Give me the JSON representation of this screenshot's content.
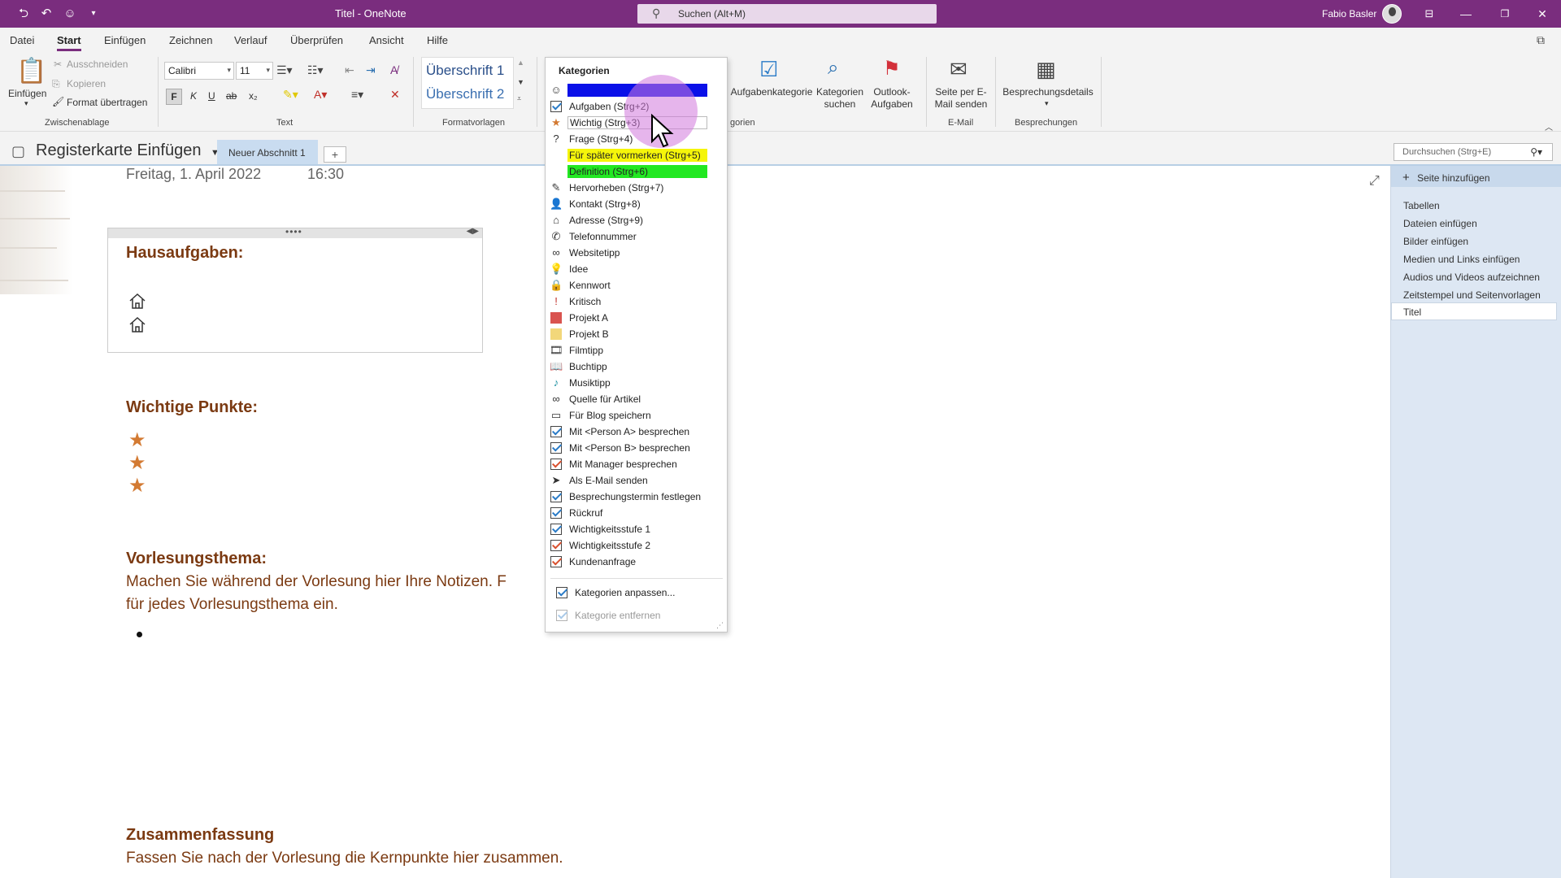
{
  "titlebar": {
    "window_title": "Titel  -  OneNote",
    "search_placeholder": "Suchen (Alt+M)",
    "user_name": "Fabio Basler"
  },
  "menu": {
    "tabs": [
      "Datei",
      "Start",
      "Einfügen",
      "Zeichnen",
      "Verlauf",
      "Überprüfen",
      "Ansicht",
      "Hilfe"
    ],
    "active": "Start"
  },
  "ribbon": {
    "clipboard": {
      "paste": "Einfügen",
      "cut": "Ausschneiden",
      "copy": "Kopieren",
      "format_painter": "Format übertragen",
      "label": "Zwischenablage"
    },
    "text": {
      "font": "Calibri",
      "size": "11",
      "bold": "F",
      "italic": "K",
      "underline": "U",
      "strike": "ab",
      "subscript": "x₂",
      "label": "Text"
    },
    "styles": {
      "style1": "Überschrift 1",
      "style2": "Überschrift 2",
      "label": "Formatvorlagen"
    },
    "tags": {
      "task_category": "Aufgabenkategorie",
      "find_tags": "Kategorien suchen",
      "outlook_tasks": "Outlook-Aufgaben",
      "label_partial": "gorien"
    },
    "email": {
      "send": "Seite per E-Mail senden",
      "label": "E-Mail"
    },
    "meetings": {
      "details": "Besprechungsdetails",
      "label": "Besprechungen"
    }
  },
  "nav": {
    "notebook": "Registerkarte Einfügen",
    "section_tab": "Neuer Abschnitt 1",
    "add_tab": "+",
    "search_placeholder": "Durchsuchen (Strg+E)"
  },
  "page": {
    "date": "Freitag, 1. April 2022",
    "time": "16:30",
    "homework_heading": "Hausaufgaben:",
    "important_heading": "Wichtige Punkte:",
    "lecture_heading": "Vorlesungsthema:",
    "lecture_text_1": "Machen Sie während der Vorlesung hier Ihre Notizen. F",
    "lecture_text_2": "für jedes Vorlesungsthema ein.",
    "summary_heading": "Zusammenfassung",
    "summary_text": "Fassen Sie nach der Vorlesung die Kernpunkte hier zusammen."
  },
  "right_pane": {
    "add_page": "Seite hinzufügen",
    "items": [
      "Tabellen",
      "Dateien einfügen",
      "Bilder einfügen",
      "Medien und Links einfügen",
      "Audios und Videos aufzeichnen",
      "Zeitstempel und Seitenvorlagen"
    ],
    "current_page": "Titel"
  },
  "dropdown": {
    "header": "Kategorien",
    "items": [
      {
        "label": "",
        "icon": "smiley-icon",
        "highlight": "#0a10e8"
      },
      {
        "label": "Aufgaben (Strg+2)",
        "icon": "checkbox-icon"
      },
      {
        "label": "Wichtig (Strg+3)",
        "icon": "star-icon"
      },
      {
        "label": "Frage (Strg+4)",
        "icon": "question-icon"
      },
      {
        "label": "Für später vormerken (Strg+5)",
        "icon": "none",
        "highlight": "#f5f50a"
      },
      {
        "label": "Definition (Strg+6)",
        "icon": "none",
        "highlight": "#22e822"
      },
      {
        "label": "Hervorheben (Strg+7)",
        "icon": "pen-icon"
      },
      {
        "label": "Kontakt (Strg+8)",
        "icon": "contact-icon"
      },
      {
        "label": "Adresse (Strg+9)",
        "icon": "home-icon"
      },
      {
        "label": "Telefonnummer",
        "icon": "phone-icon"
      },
      {
        "label": "Websitetipp",
        "icon": "link-icon"
      },
      {
        "label": "Idee",
        "icon": "lightbulb-icon"
      },
      {
        "label": "Kennwort",
        "icon": "lock-icon"
      },
      {
        "label": "Kritisch",
        "icon": "exclamation-icon"
      },
      {
        "label": "Projekt A",
        "icon": "red-square-icon"
      },
      {
        "label": "Projekt B",
        "icon": "yellow-square-icon"
      },
      {
        "label": "Filmtipp",
        "icon": "film-icon"
      },
      {
        "label": "Buchtipp",
        "icon": "book-icon"
      },
      {
        "label": "Musiktipp",
        "icon": "music-note-icon"
      },
      {
        "label": "Quelle für Artikel",
        "icon": "link-icon"
      },
      {
        "label": "Für Blog speichern",
        "icon": "comment-icon"
      },
      {
        "label": "Mit <Person A> besprechen",
        "icon": "checkbox-icon"
      },
      {
        "label": "Mit <Person B> besprechen",
        "icon": "checkbox-icon"
      },
      {
        "label": "Mit Manager besprechen",
        "icon": "checkbox-red-icon"
      },
      {
        "label": "Als E-Mail senden",
        "icon": "send-icon"
      },
      {
        "label": "Besprechungstermin festlegen",
        "icon": "checkbox-icon"
      },
      {
        "label": "Rückruf",
        "icon": "checkbox-icon"
      },
      {
        "label": "Wichtigkeitsstufe 1",
        "icon": "checkbox-icon"
      },
      {
        "label": "Wichtigkeitsstufe 2",
        "icon": "checkbox-red-icon"
      },
      {
        "label": "Kundenanfrage",
        "icon": "checkbox-red-icon"
      }
    ],
    "customize": "Kategorien anpassen...",
    "remove": "Kategorie entfernen"
  },
  "colors": {
    "accent": "#7a2d7e",
    "heading": "#7b3a12",
    "star": "#d37a32"
  }
}
